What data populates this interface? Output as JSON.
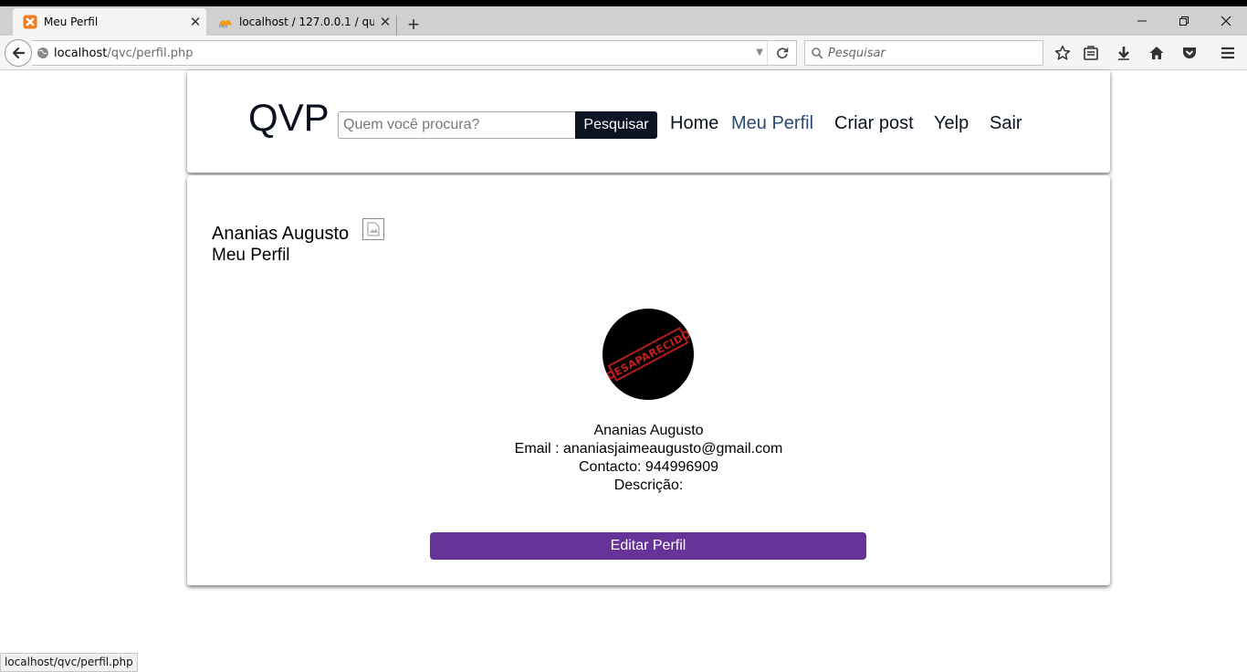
{
  "browser": {
    "tabs": [
      {
        "title": "Meu Perfil",
        "icon": "xampp-icon",
        "active": true
      },
      {
        "title": "localhost / 127.0.0.1 / que...",
        "icon": "phpmyadmin-icon",
        "active": false
      }
    ],
    "url_host": "localhost",
    "url_path": "/qvc/perfil.php",
    "search_placeholder": "Pesquisar",
    "status_url": "localhost/qvc/perfil.php"
  },
  "header": {
    "logo": "QVP",
    "search_placeholder": "Quem você procura?",
    "search_button": "Pesquisar",
    "nav": [
      {
        "label": "Home",
        "active": false
      },
      {
        "label": "Meu Perfil",
        "active": true
      },
      {
        "label": "Criar post",
        "active": false
      },
      {
        "label": "Yelp",
        "active": false
      },
      {
        "label": "Sair",
        "active": false
      }
    ]
  },
  "profile": {
    "name": "Ananias Augusto",
    "subtitle": "Meu Perfil",
    "avatar_stamp": "DESAPARECIDO",
    "display_name": "Ananias Augusto",
    "email_line": "Email : ananiasjaimeaugusto@gmail.com",
    "contact_line": "Contacto: 944996909",
    "description_line": "Descrição:",
    "edit_button": "Editar Perfil"
  },
  "colors": {
    "nav_active": "#2b4a73",
    "search_button_bg": "#0b1222",
    "edit_button_bg": "#663399"
  }
}
